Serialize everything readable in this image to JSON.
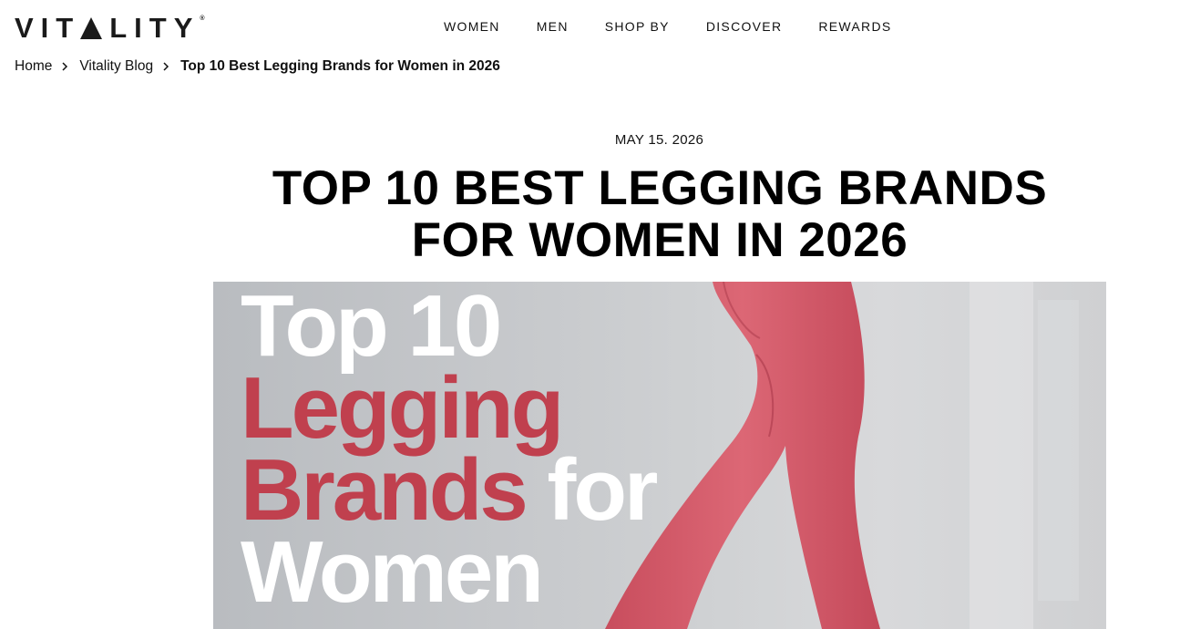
{
  "header": {
    "logo": "VITALITY",
    "logo_mark": "®",
    "nav": [
      "WOMEN",
      "MEN",
      "SHOP BY",
      "DISCOVER",
      "REWARDS"
    ]
  },
  "breadcrumb": {
    "home": "Home",
    "blog": "Vitality Blog",
    "current": "Top 10 Best Legging Brands for Women in 2026"
  },
  "article": {
    "date": "MAY 15. 2026",
    "title_line1": "TOP 10 BEST LEGGING BRANDS",
    "title_line2": "FOR WOMEN IN 2026",
    "hero": {
      "line1": "Top 10",
      "line2": "Legging",
      "line3a": "Brands",
      "line3b": " for",
      "line4": "Women",
      "colors": {
        "white_text": "#ffffff",
        "red_text": "#c0404e",
        "legging": "#d45d6b"
      }
    }
  }
}
